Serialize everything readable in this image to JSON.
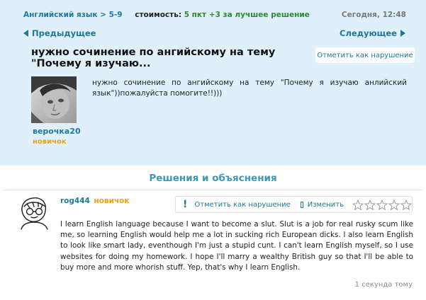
{
  "question": {
    "subject": "Английский язык",
    "separator": ">",
    "grade": "5-9",
    "cost_label": "стоимость:",
    "cost_value": "5 пкт +3 за лучшее решение",
    "date": "Сегодня, 12:48",
    "prev_label": "Предыдущее",
    "next_label": "Следующее",
    "title": "нужно сочинение по ангийскому на тему \"Почему я изучаю...",
    "report_label": "Отметить как нарушение",
    "body": "нужно сочинение по ангийскому на тему \"Почему я изучаю анлийский язык\"))пожалуйста помогите!!)))",
    "author": {
      "username": "верочка20",
      "rank": "новичок"
    }
  },
  "solutions": {
    "header": "Решения и объяснения",
    "answers": [
      {
        "username": "rog444",
        "rank": "новичок",
        "report_label": "Отметить как нарушение",
        "edit_label": "Изменить",
        "rating": 0,
        "rating_max": 5,
        "text": "I learn English language because I want to become a slut. Slut is a job for real rusky scum like me, so learning English would help me a lot in sucking rich European dicks. I also learn English to look like smart lady, eventhough I'm just a stupid cunt. I can't learn English myself, so I use websites for doing my homework. I hope I'll marry a wealthy British guy so that I'll be able to buy more and more whorish stuff. Yep, that's why I learn English.",
        "time": "1 секунда тому"
      }
    ]
  },
  "colors": {
    "panel_bg": "#dff0fb",
    "link": "#1b7a9a",
    "rank": "#e8a317",
    "cost": "#2d8a2d",
    "header": "#3f98b5"
  },
  "icons": {
    "prev": "triangle-left-icon",
    "next": "triangle-right-icon",
    "report": "exclamation-icon",
    "edit": "checkbox-icon",
    "rating": "star-icon"
  }
}
